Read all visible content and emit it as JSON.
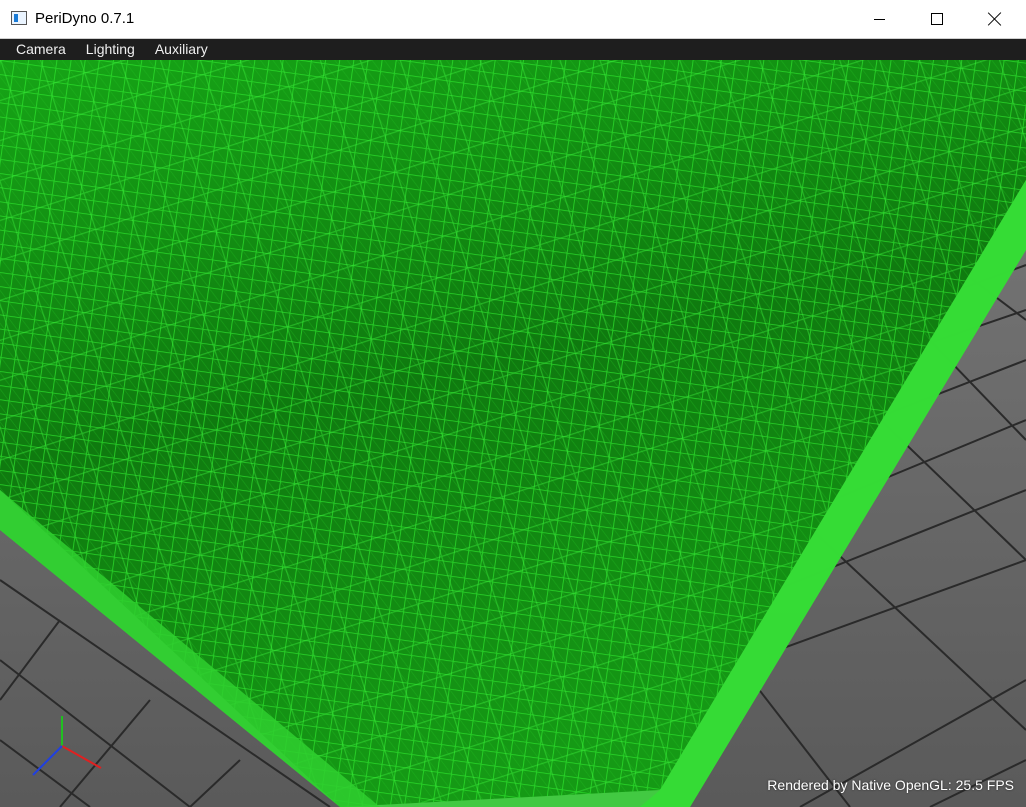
{
  "window": {
    "title": "PeriDyno 0.7.1"
  },
  "menu": {
    "items": [
      "Camera",
      "Lighting",
      "Auxiliary"
    ]
  },
  "viewport": {
    "status_text": "Rendered by Native OpenGL: 25.5 FPS",
    "lattice_color": "#1fd11f",
    "floor_color": "#6c6c6c",
    "floor_line_color": "#2a2a2a",
    "axis_colors": {
      "x": "#e02020",
      "y": "#20c020",
      "z": "#2040e0"
    }
  }
}
